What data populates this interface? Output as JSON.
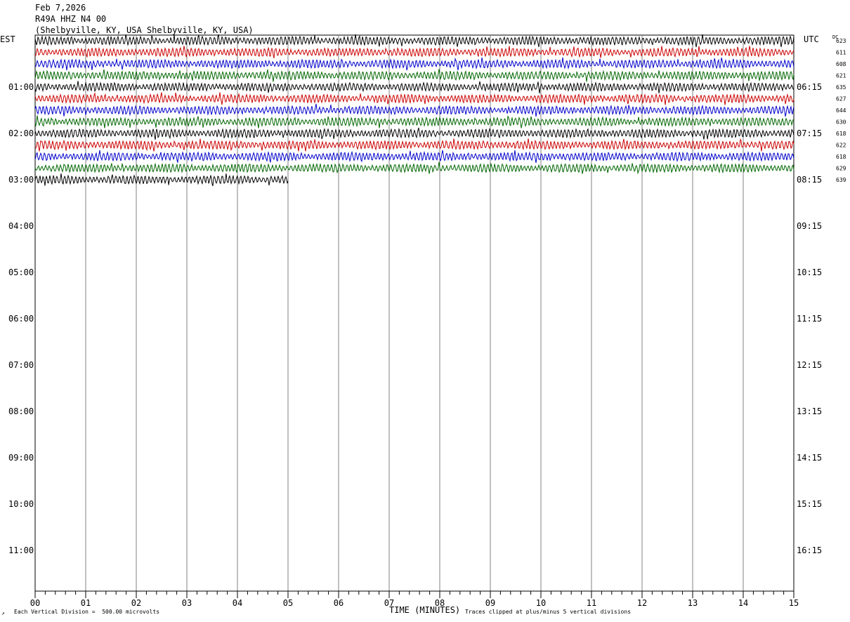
{
  "header": {
    "date": "Feb 7,2026",
    "station": "R49A HHZ N4 00",
    "location": "(Shelbyville, KY, USA Shelbyville, KY, USA)"
  },
  "tz_left": "EST",
  "tz_right": "UTC",
  "dc_label": "DC",
  "footer": {
    "scale": "Each Vertical Division =  500.00 microvolts",
    "clip": "Traces clipped at plus/minus 5 vertical divisions",
    "corner": "↗"
  },
  "chart_data": {
    "type": "line",
    "xlabel": "TIME (MINUTES)",
    "xlim": [
      0,
      15
    ],
    "x_ticks": [
      "00",
      "01",
      "02",
      "03",
      "04",
      "05",
      "06",
      "07",
      "08",
      "09",
      "10",
      "11",
      "12",
      "13",
      "14",
      "15"
    ],
    "left_hour_labels": [
      "01:00",
      "02:00",
      "03:00",
      "04:00",
      "05:00",
      "06:00",
      "07:00",
      "08:00",
      "09:00",
      "10:00",
      "11:00"
    ],
    "right_hour_labels": [
      "06:15",
      "07:15",
      "08:15",
      "09:15",
      "10:15",
      "11:15",
      "12:15",
      "13:15",
      "14:15",
      "15:15",
      "16:15"
    ],
    "trace_colors": [
      "#000000",
      "#cc0000",
      "#0000cc",
      "#006600"
    ],
    "dc_offsets": [
      623,
      611,
      608,
      621,
      635,
      627,
      644,
      630,
      618,
      622,
      618,
      629,
      639
    ],
    "trace_end_minutes": [
      15,
      15,
      15,
      15,
      15,
      15,
      15,
      15,
      15,
      15,
      15,
      15,
      5
    ],
    "grid": true
  }
}
